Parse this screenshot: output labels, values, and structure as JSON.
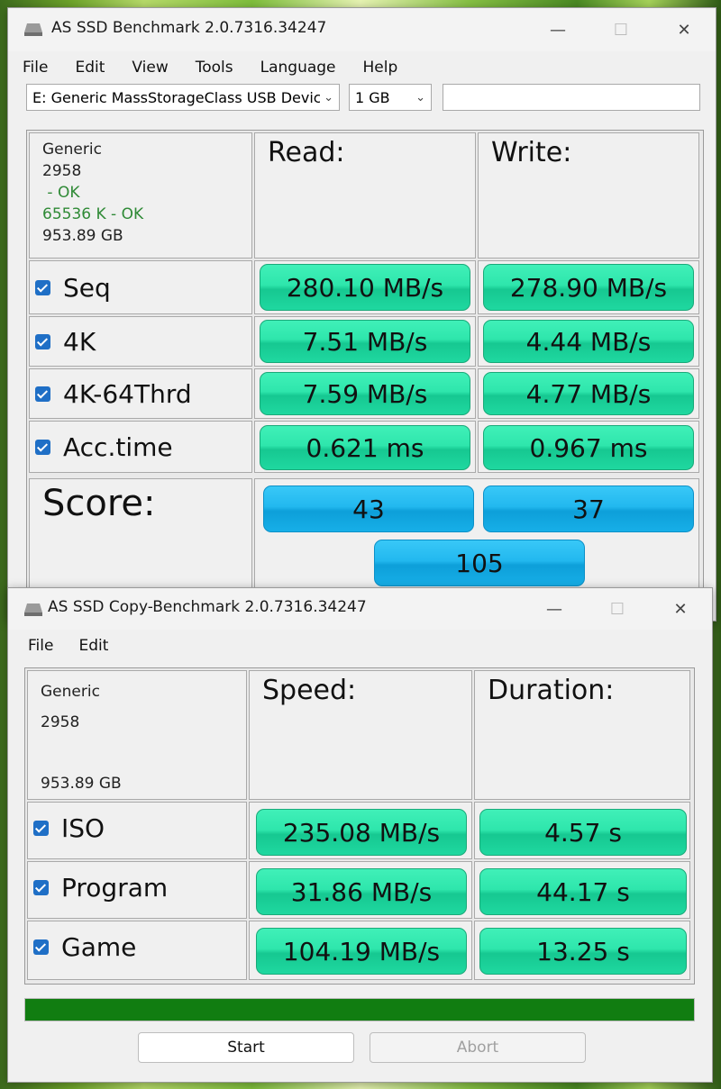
{
  "benchmark": {
    "title": "AS SSD Benchmark 2.0.7316.34247",
    "menu": [
      "File",
      "Edit",
      "View",
      "Tools",
      "Language",
      "Help"
    ],
    "drive_select": "E: Generic MassStorageClass USB Device",
    "size_select": "1 GB",
    "info": {
      "model": "Generic",
      "firmware": "2958",
      "driver_status": " - OK",
      "alignment": "65536 K - OK",
      "capacity": "953.89 GB"
    },
    "read_label": "Read:",
    "write_label": "Write:",
    "rows": [
      {
        "label": "Seq",
        "read": "280.10 MB/s",
        "write": "278.90 MB/s"
      },
      {
        "label": "4K",
        "read": "7.51 MB/s",
        "write": "4.44 MB/s"
      },
      {
        "label": "4K-64Thrd",
        "read": "7.59 MB/s",
        "write": "4.77 MB/s"
      },
      {
        "label": "Acc.time",
        "read": "0.621 ms",
        "write": "0.967 ms"
      }
    ],
    "score_label": "Score:",
    "score_read": "43",
    "score_write": "37",
    "score_total": "105"
  },
  "copy": {
    "title": "AS SSD Copy-Benchmark 2.0.7316.34247",
    "menu": [
      "File",
      "Edit"
    ],
    "info": {
      "model": "Generic",
      "firmware": "2958",
      "capacity": "953.89 GB"
    },
    "speed_label": "Speed:",
    "duration_label": "Duration:",
    "rows": [
      {
        "label": "ISO",
        "speed": "235.08 MB/s",
        "duration": "4.57 s"
      },
      {
        "label": "Program",
        "speed": "31.86 MB/s",
        "duration": "44.17 s"
      },
      {
        "label": "Game",
        "speed": "104.19 MB/s",
        "duration": "13.25 s"
      }
    ],
    "progress": 1.0,
    "start_label": "Start",
    "abort_label": "Abort"
  },
  "window_controls": {
    "minimize": "—",
    "maximize": "☐",
    "close": "✕"
  },
  "colors": {
    "pill_green": "#2ee6ac",
    "pill_blue": "#22b8ef",
    "progress": "#117d11"
  }
}
